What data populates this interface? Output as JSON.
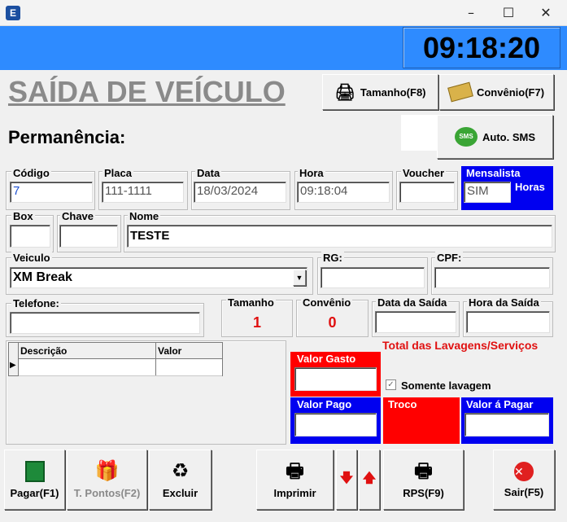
{
  "window": {
    "app_icon_letter": "E",
    "minimize": "–",
    "maximize": "☐",
    "close": "✕"
  },
  "clock": "09:18:20",
  "title": "SAÍDA DE VEÍCULO",
  "buttons": {
    "tamanho": "Tamanho(F8)",
    "convenio": "Convênio(F7)",
    "sms": "Auto. SMS",
    "sms_badge": "SMS"
  },
  "permanencia_label": "Permanência:",
  "fields": {
    "codigo": {
      "label": "Código",
      "value": "7"
    },
    "placa": {
      "label": "Placa",
      "value": "111-1111"
    },
    "data": {
      "label": "Data",
      "value": "18/03/2024"
    },
    "hora": {
      "label": "Hora",
      "value": "09:18:04"
    },
    "voucher": {
      "label": "Voucher",
      "value": ""
    },
    "mensalista": {
      "label": "Mensalista",
      "value": "SIM",
      "extra": "Horas"
    },
    "box": {
      "label": "Box",
      "value": ""
    },
    "chave": {
      "label": "Chave",
      "value": ""
    },
    "nome": {
      "label": "Nome",
      "value": "TESTE"
    },
    "veiculo": {
      "label": "Veiculo",
      "value": "XM Break"
    },
    "rg": {
      "label": "RG:",
      "value": ""
    },
    "cpf": {
      "label": "CPF:",
      "value": ""
    },
    "telefone": {
      "label": "Telefone:",
      "value": ""
    },
    "tamanho": {
      "label": "Tamanho",
      "value": "1"
    },
    "convenio": {
      "label": "Convênio",
      "value": "0"
    },
    "data_saida": {
      "label": "Data da Saída",
      "value": ""
    },
    "hora_saida": {
      "label": "Hora da Saída",
      "value": ""
    }
  },
  "grid": {
    "columns": [
      "Descrição",
      "Valor"
    ],
    "row_marker": "▶"
  },
  "totals": {
    "heading": "Total das Lavagens/Serviços",
    "valor_gasto": "Valor Gasto",
    "valor_pago": "Valor Pago",
    "troco": "Troco",
    "valor_a_pagar": "Valor á Pagar",
    "somente_lavagem": "Somente lavagem"
  },
  "bottom": {
    "pagar": "Pagar(F1)",
    "pontos": "T. Pontos(F2)",
    "excluir": "Excluir",
    "imprimir": "Imprimir",
    "down": "🡇",
    "up": "🡅",
    "rps": "RPS(F9)",
    "sair": "Sair(F5)"
  },
  "colors": {
    "accent_blue": "#2e8bff",
    "panel_red": "#ff0000",
    "panel_blue": "#0000f0",
    "value_red": "#e01010"
  }
}
